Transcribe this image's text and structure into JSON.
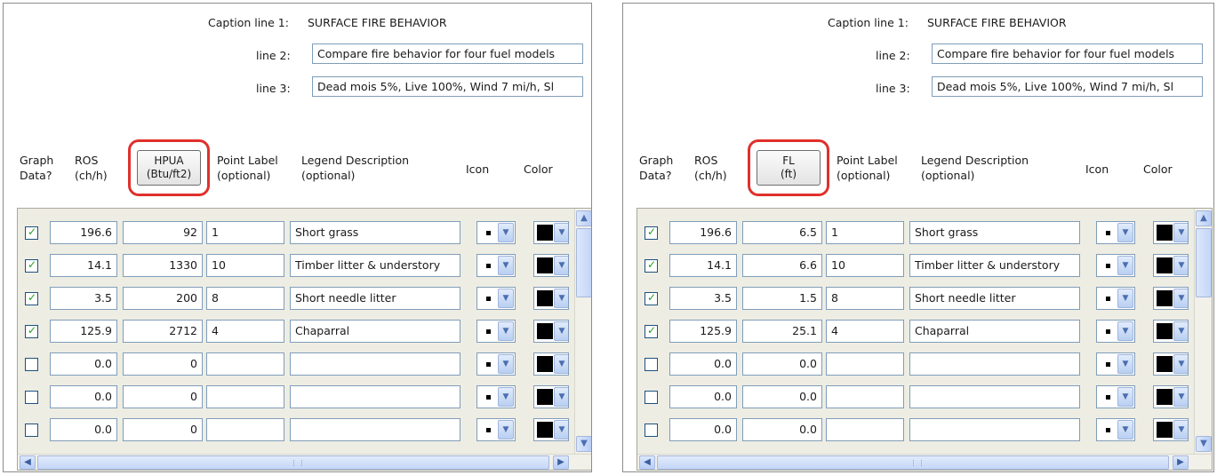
{
  "panels": [
    {
      "caption": {
        "line1_label": "Caption line 1:",
        "line1_value": "SURFACE FIRE BEHAVIOR",
        "line2_label": "line 2:",
        "line2_value": "Compare fire behavior for four fuel models",
        "line3_label": "line 3:",
        "line3_value": "Dead mois 5%, Live 100%, Wind 7 mi/h, Sl"
      },
      "headers": {
        "graph_data": "Graph\nData?",
        "ros": "ROS\n(ch/h)",
        "column_button": "HPUA\n(Btu/ft2)",
        "point_label": "Point Label\n(optional)",
        "legend": "Legend Description\n(optional)",
        "icon": "Icon",
        "color": "Color"
      },
      "rows": [
        {
          "checked": true,
          "ros": "196.6",
          "value": "92",
          "point": "1",
          "legend": "Short grass"
        },
        {
          "checked": true,
          "ros": "14.1",
          "value": "1330",
          "point": "10",
          "legend": "Timber litter & understory"
        },
        {
          "checked": true,
          "ros": "3.5",
          "value": "200",
          "point": "8",
          "legend": "Short needle litter"
        },
        {
          "checked": true,
          "ros": "125.9",
          "value": "2712",
          "point": "4",
          "legend": "Chaparral"
        },
        {
          "checked": false,
          "ros": "0.0",
          "value": "0",
          "point": "",
          "legend": ""
        },
        {
          "checked": false,
          "ros": "0.0",
          "value": "0",
          "point": "",
          "legend": ""
        },
        {
          "checked": false,
          "ros": "0.0",
          "value": "0",
          "point": "",
          "legend": ""
        }
      ]
    },
    {
      "caption": {
        "line1_label": "Caption line 1:",
        "line1_value": "SURFACE FIRE BEHAVIOR",
        "line2_label": "line 2:",
        "line2_value": "Compare fire behavior for four fuel models",
        "line3_label": "line 3:",
        "line3_value": "Dead mois 5%, Live 100%, Wind 7 mi/h, Sl"
      },
      "headers": {
        "graph_data": "Graph\nData?",
        "ros": "ROS\n(ch/h)",
        "column_button": "FL\n(ft)",
        "point_label": "Point Label\n(optional)",
        "legend": "Legend Description\n(optional)",
        "icon": "Icon",
        "color": "Color"
      },
      "rows": [
        {
          "checked": true,
          "ros": "196.6",
          "value": "6.5",
          "point": "1",
          "legend": "Short grass"
        },
        {
          "checked": true,
          "ros": "14.1",
          "value": "6.6",
          "point": "10",
          "legend": "Timber litter & understory"
        },
        {
          "checked": true,
          "ros": "3.5",
          "value": "1.5",
          "point": "8",
          "legend": "Short needle litter"
        },
        {
          "checked": true,
          "ros": "125.9",
          "value": "25.1",
          "point": "4",
          "legend": "Chaparral"
        },
        {
          "checked": false,
          "ros": "0.0",
          "value": "0.0",
          "point": "",
          "legend": ""
        },
        {
          "checked": false,
          "ros": "0.0",
          "value": "0.0",
          "point": "",
          "legend": ""
        },
        {
          "checked": false,
          "ros": "0.0",
          "value": "0.0",
          "point": "",
          "legend": ""
        }
      ]
    }
  ],
  "colors": {
    "highlight_ring": "#e0302c",
    "check_mark": "#21a121",
    "grid_background": "#eeede3"
  },
  "icons": {
    "check": "✓",
    "dropdown": "▼",
    "scroll_up": "▲",
    "scroll_down": "▼",
    "scroll_left": "◀",
    "scroll_right": "▶"
  }
}
